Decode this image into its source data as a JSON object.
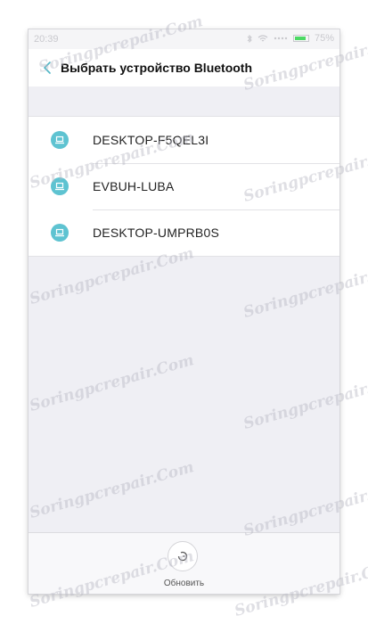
{
  "status_bar": {
    "time": "20:39",
    "battery": "75%"
  },
  "header": {
    "title": "Выбрать устройство Bluetooth"
  },
  "devices": [
    {
      "name": "DESKTOP-F5QEL3I"
    },
    {
      "name": "EVBUH-LUBA"
    },
    {
      "name": "DESKTOP-UMPRB0S"
    }
  ],
  "footer": {
    "refresh_label": "Обновить"
  },
  "watermark": {
    "text": "Soringpcrepair.Com"
  },
  "colors": {
    "accent": "#5ec3d1",
    "background": "#efeff4",
    "battery": "#4cd964"
  },
  "icons": {
    "back": "chevron-left-icon",
    "device": "laptop-icon",
    "refresh": "refresh-icon"
  }
}
